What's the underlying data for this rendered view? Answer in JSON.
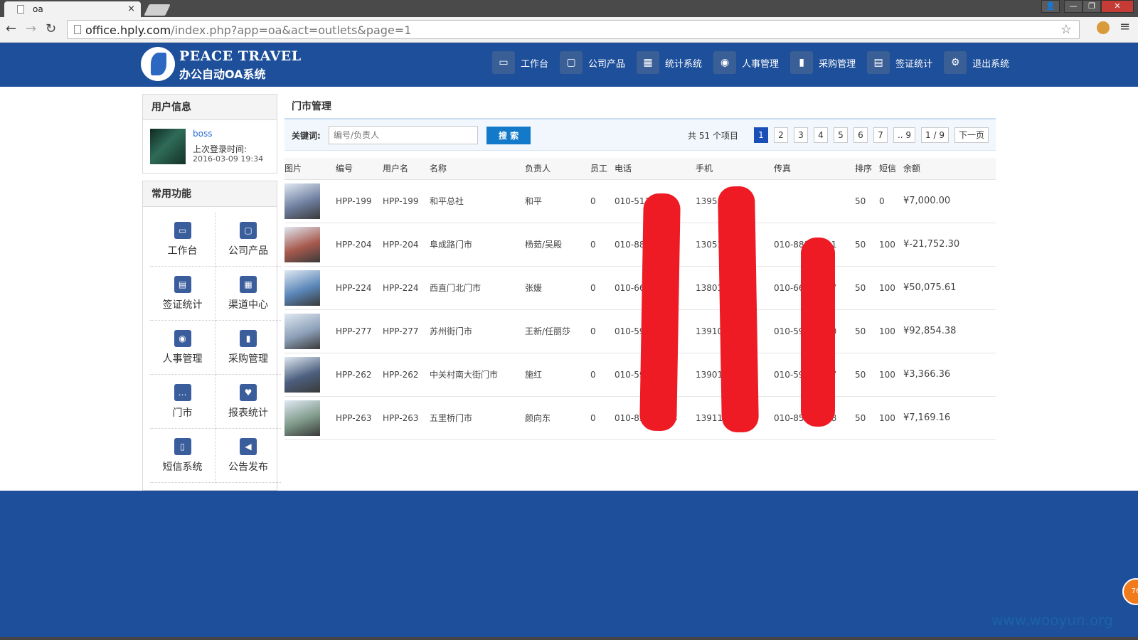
{
  "browser": {
    "tab_title": "oa",
    "tab_close": "×",
    "url_host": "office.hply.com",
    "url_path": "/index.php?app=oa&act=outlets&page=1",
    "back": "←",
    "forward": "→",
    "reload": "↻",
    "star": "☆",
    "menu": "≡",
    "win_user": "👤",
    "win_min": "—",
    "win_max": "❐",
    "win_close": "✕"
  },
  "header": {
    "brand_en": "PEACE TRAVEL",
    "brand_cn": "办公自动OA系统",
    "nav": [
      {
        "label": "工作台",
        "icon": "monitor-icon",
        "glyph": "▭"
      },
      {
        "label": "公司产品",
        "icon": "frame-icon",
        "glyph": "▢"
      },
      {
        "label": "统计系统",
        "icon": "chart-icon",
        "glyph": "▦"
      },
      {
        "label": "人事管理",
        "icon": "people-icon",
        "glyph": "◉"
      },
      {
        "label": "采购管理",
        "icon": "purchase-icon",
        "glyph": "▮"
      },
      {
        "label": "签证统计",
        "icon": "visa-icon",
        "glyph": "▤"
      },
      {
        "label": "退出系统",
        "icon": "gear-icon",
        "glyph": "⚙"
      }
    ]
  },
  "user_panel": {
    "title": "用户信息",
    "username": "boss",
    "last_login_label": "上次登录时间:",
    "last_login_time": "2016-03-09 19:34"
  },
  "functions_panel": {
    "title": "常用功能",
    "items": [
      {
        "label": "工作台",
        "icon": "monitor-icon",
        "glyph": "▭"
      },
      {
        "label": "公司产品",
        "icon": "frame-icon",
        "glyph": "▢"
      },
      {
        "label": "签证统计",
        "icon": "visa-icon",
        "glyph": "▤"
      },
      {
        "label": "渠道中心",
        "icon": "channel-icon",
        "glyph": "▦"
      },
      {
        "label": "人事管理",
        "icon": "people-icon",
        "glyph": "◉"
      },
      {
        "label": "采购管理",
        "icon": "purchase-icon",
        "glyph": "▮"
      },
      {
        "label": "门市",
        "icon": "chat-icon",
        "glyph": "…"
      },
      {
        "label": "报表统计",
        "icon": "heart-icon",
        "glyph": "♥"
      },
      {
        "label": "短信系统",
        "icon": "phone-icon",
        "glyph": "▯"
      },
      {
        "label": "公告发布",
        "icon": "speaker-icon",
        "glyph": "◀"
      }
    ]
  },
  "main": {
    "title": "门市管理",
    "search": {
      "label": "关键词:",
      "placeholder": "编号/负责人",
      "button": "搜 索"
    },
    "pager": {
      "total": "共 51 个项目",
      "pages": [
        "1",
        "2",
        "3",
        "4",
        "5",
        "6",
        "7",
        ".. 9",
        "1 / 9",
        "下一页"
      ],
      "current": "1"
    },
    "columns": [
      "图片",
      "编号",
      "用户名",
      "名称",
      "负责人",
      "员工",
      "电话",
      "手机",
      "传真",
      "排序",
      "短信",
      "余额"
    ],
    "rows": [
      {
        "code": "HPP-199",
        "user": "HPP-199",
        "name": "和平总社",
        "manager": "和平",
        "staff": "0",
        "phone": "010-51319050",
        "mobile": "13951318750",
        "fax": "",
        "sort": "50",
        "sms": "0",
        "balance": "¥7,000.00",
        "thumb": "#6f7fa0"
      },
      {
        "code": "HPP-204",
        "user": "HPP-204",
        "name": "阜成路门市",
        "manager": "杨茹/吴殿",
        "staff": "0",
        "phone": "010-88126191",
        "mobile": "13051346319",
        "fax": "010-88126191",
        "sort": "50",
        "sms": "100",
        "balance": "¥-21,752.30",
        "thumb": "#a85a4e"
      },
      {
        "code": "HPP-224",
        "user": "HPP-224",
        "name": "西直门北门市",
        "manager": "张媛",
        "staff": "0",
        "phone": "010-66139557",
        "mobile": "13801341192",
        "fax": "010-66139557",
        "sort": "50",
        "sms": "100",
        "balance": "¥50,075.61",
        "thumb": "#5a86b8"
      },
      {
        "code": "HPP-277",
        "user": "HPP-277",
        "name": "苏州街门市",
        "manager": "王新/任丽莎",
        "staff": "0",
        "phone": "010-59790080",
        "mobile": "13910326809",
        "fax": "010-59790080",
        "sort": "50",
        "sms": "100",
        "balance": "¥92,854.38",
        "thumb": "#8da0b8"
      },
      {
        "code": "HPP-262",
        "user": "HPP-262",
        "name": "中关村南大街门市",
        "manager": "施红",
        "staff": "0",
        "phone": "010-59581317",
        "mobile": "13901318169",
        "fax": "010-59581317",
        "sort": "50",
        "sms": "100",
        "balance": "¥3,366.36",
        "thumb": "#4c5f7e"
      },
      {
        "code": "HPP-263",
        "user": "HPP-263",
        "name": "五里桥门市",
        "manager": "颜向东",
        "staff": "0",
        "phone": "010-85738008",
        "mobile": "13911365127",
        "fax": "010-85738008",
        "sort": "50",
        "sms": "100",
        "balance": "¥7,169.16",
        "thumb": "#7f9a8a"
      }
    ]
  },
  "footer": {
    "badge": "76",
    "watermark": "www.wooyun.org"
  }
}
